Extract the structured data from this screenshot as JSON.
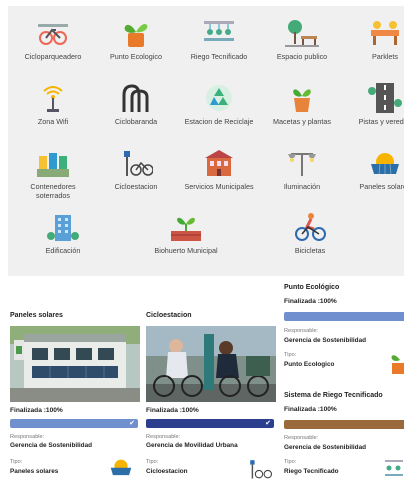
{
  "categories": [
    {
      "label": "Cicloparqueadero",
      "icon": "bicycle-parking-icon"
    },
    {
      "label": "Punto Ecologico",
      "icon": "eco-point-icon"
    },
    {
      "label": "Riego Tecnificado",
      "icon": "irrigation-icon"
    },
    {
      "label": "Espacio publico",
      "icon": "public-space-icon"
    },
    {
      "label": "Parklets",
      "icon": "parklet-icon"
    },
    {
      "label": "Zona Wifi",
      "icon": "wifi-zone-icon"
    },
    {
      "label": "Ciclobaranda",
      "icon": "bike-rail-icon"
    },
    {
      "label": "Estacion de Reciclaje",
      "icon": "recycling-station-icon"
    },
    {
      "label": "Macetas y plantas",
      "icon": "plant-pot-icon"
    },
    {
      "label": "Pistas y veredas",
      "icon": "road-icon"
    },
    {
      "label": "Contenedores soterrados",
      "icon": "underground-containers-icon"
    },
    {
      "label": "Cicloestacion",
      "icon": "bike-station-icon"
    },
    {
      "label": "Servicios Municipales",
      "icon": "municipal-building-icon"
    },
    {
      "label": "Iluminación",
      "icon": "street-light-icon"
    },
    {
      "label": "Paneles solares",
      "icon": "solar-panel-icon"
    },
    {
      "label": "Edificación",
      "icon": "building-icon"
    },
    {
      "label": "Biohuerto Municipal",
      "icon": "garden-icon"
    },
    {
      "label": "Bicicletas",
      "icon": "cyclist-icon"
    }
  ],
  "projects": [
    {
      "title": "Paneles solares",
      "status": "Finalizada :100%",
      "responsable_label": "Responsable:",
      "responsable": "Gerencia de Sostenibilidad",
      "tipo_label": "Tipo:",
      "tipo": "Paneles solares",
      "bar_color": "#6f8fcf",
      "icon": "solar-panel-icon"
    },
    {
      "title": "Cicloestacion",
      "status": "Finalizada :100%",
      "responsable_label": "Responsable:",
      "responsable": "Gerencia de Movilidad Urbana",
      "tipo_label": "Tipo:",
      "tipo": "Cicloestacion",
      "bar_color": "#2c3f8f",
      "icon": "bike-station-icon"
    },
    {
      "title": "Punto Ecológico",
      "status": "Finalizada :100%",
      "responsable_label": "Responsable:",
      "responsable": "Gerencia de Sostenibilidad",
      "tipo_label": "Tipo:",
      "tipo": "Punto Ecologico",
      "bar_color": "#6f8fcf",
      "icon": "eco-point-icon"
    },
    {
      "title": "Sistema de Riego Tecnificado",
      "status": "Finalizada :100%",
      "responsable_label": "Responsable:",
      "responsable": "Gerencia de Sostenibilidad",
      "tipo_label": "Tipo:",
      "tipo": "Riego Tecnificado",
      "bar_color": "#9b6a3c",
      "icon": "irrigation-icon"
    }
  ],
  "progress": [
    1.0,
    1.0,
    1.0,
    1.0
  ]
}
